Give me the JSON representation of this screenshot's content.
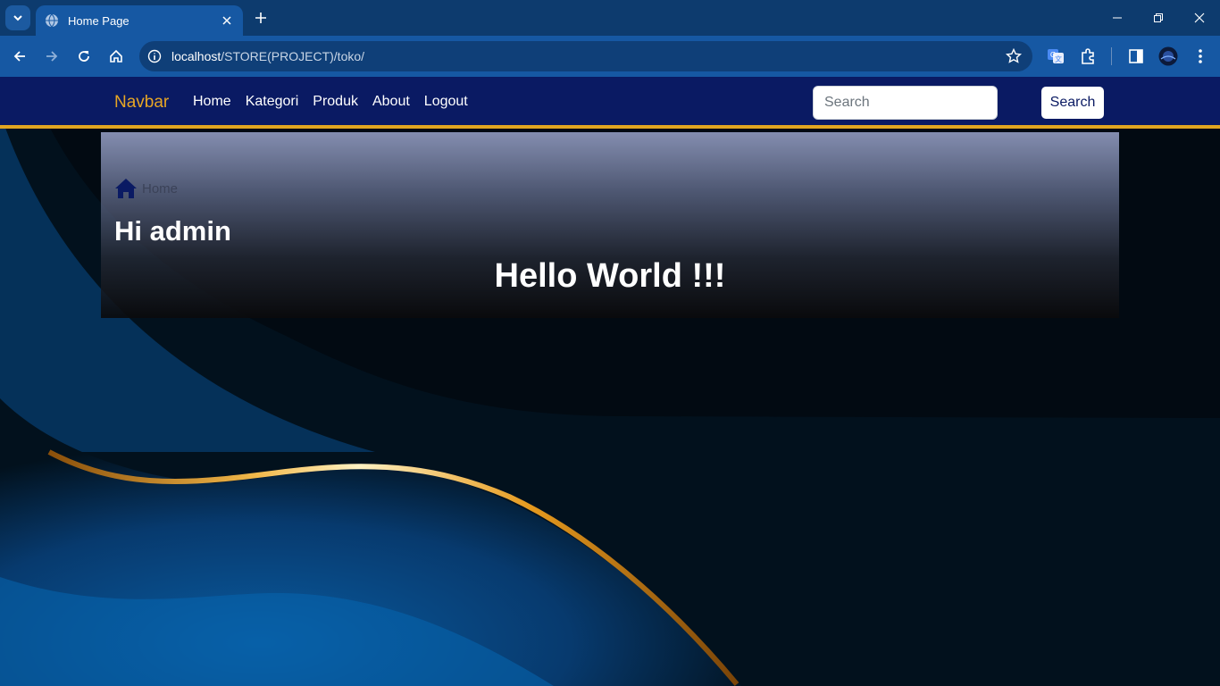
{
  "browser": {
    "tab": {
      "title": "Home Page"
    },
    "address": {
      "host": "localhost",
      "path": "/STORE(PROJECT)/toko/"
    }
  },
  "navbar": {
    "brand": "Navbar",
    "links": [
      "Home",
      "Kategori",
      "Produk",
      "About",
      "Logout"
    ],
    "search_placeholder": "Search",
    "search_button": "Search"
  },
  "hero": {
    "breadcrumb": "Home",
    "greeting": "Hi admin",
    "heading": "Hello World !!!"
  },
  "colors": {
    "navbar_bg": "#0a1a63",
    "accent_gold": "#e7a625",
    "chrome_blue": "#1658a3"
  },
  "icons": [
    "tab-search-icon",
    "globe-icon",
    "close-icon",
    "plus-icon",
    "minimize-icon",
    "restore-icon",
    "back-icon",
    "forward-icon",
    "reload-icon",
    "home-icon",
    "info-icon",
    "star-icon",
    "translate-icon",
    "extensions-icon",
    "sidebar-icon",
    "profile-avatar",
    "menu-icon",
    "breadcrumb-home-icon"
  ]
}
